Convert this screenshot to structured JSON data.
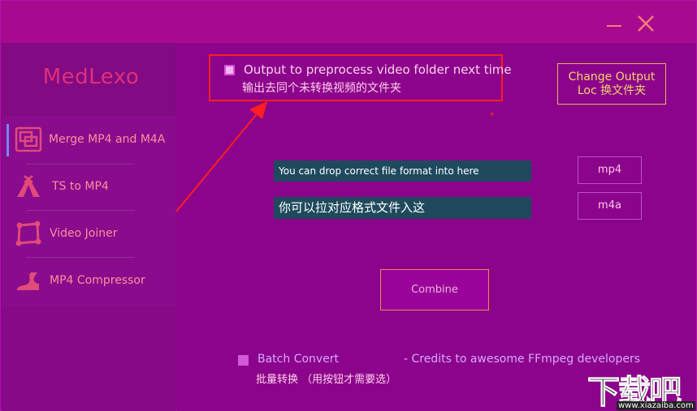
{
  "app": {
    "brand": "MedLexo"
  },
  "titlebar": {
    "minimize_label": "—",
    "close_label": "✕"
  },
  "sidebar": {
    "items": [
      {
        "label": "Merge MP4 and M4A",
        "icon": "merge-icon",
        "active": true
      },
      {
        "label": "TS to MP4",
        "icon": "tent-icon",
        "active": false
      },
      {
        "label": "Video Joiner",
        "icon": "joiner-frame-icon",
        "active": false
      },
      {
        "label": "MP4 Compressor",
        "icon": "compressor-icon",
        "active": false
      }
    ]
  },
  "options": {
    "output_preprocess": {
      "label": "Output to preprocess video folder next time",
      "sublabel": "输出去同个未转换视频的文件夹",
      "checked": true
    },
    "change_output": {
      "line1": "Change Output",
      "line2": "Loc 换文件夹"
    }
  },
  "drop": {
    "mp4_hint": "You can drop correct file format into here",
    "m4a_hint": "你可以拉对应格式文件入这",
    "mp4_button": "mp4",
    "m4a_button": "m4a"
  },
  "actions": {
    "combine": "Combine"
  },
  "footer": {
    "batch_label": "Batch Convert",
    "batch_sub": "批量转换 （用按钮才需要选）",
    "credits": "- Credits to awesome FFmpeg developers"
  },
  "watermark": {
    "text": "下载吧",
    "url": "www.xiazaiba.com"
  },
  "colors": {
    "accent_red": "#ff1e1e",
    "brand": "#e0307a",
    "outline": "#e8b25a"
  }
}
